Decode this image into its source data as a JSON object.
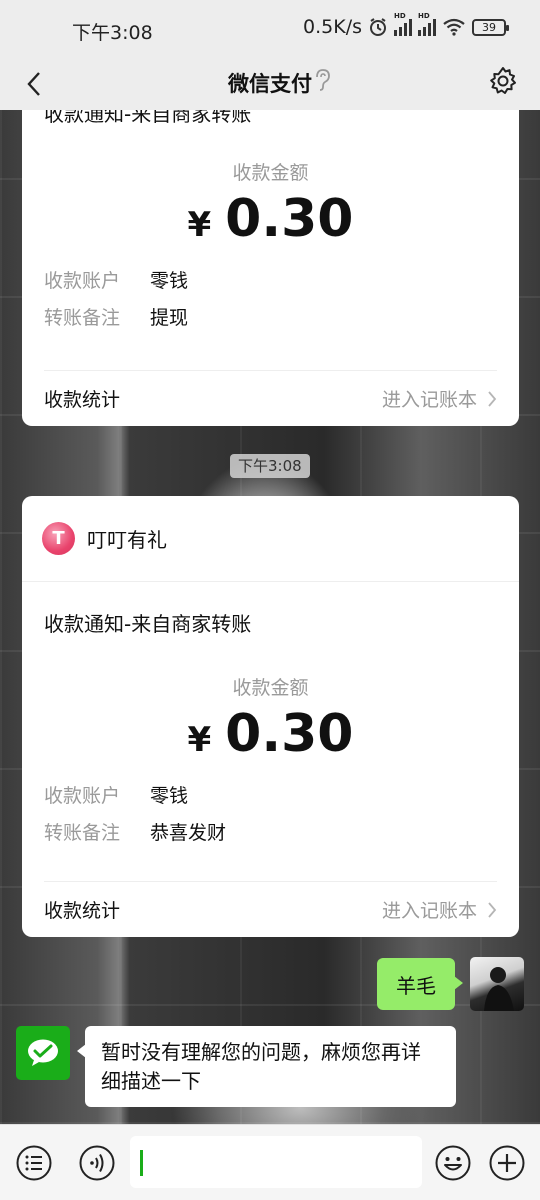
{
  "status_bar": {
    "time": "下午3:08",
    "network_speed": "0.5K/s",
    "battery": "39"
  },
  "nav": {
    "title": "微信支付"
  },
  "cards": [
    {
      "title": "收款通知-来自商家转账",
      "amount_label": "收款金额",
      "currency": "¥",
      "amount": "0.30",
      "details": [
        {
          "key": "收款账户",
          "value": "零钱"
        },
        {
          "key": "转账备注",
          "value": "提现"
        }
      ],
      "footer_left": "收款统计",
      "footer_right": "进入记账本"
    },
    {
      "brand": "叮叮有礼",
      "title": "收款通知-来自商家转账",
      "amount_label": "收款金额",
      "currency": "¥",
      "amount": "0.30",
      "details": [
        {
          "key": "收款账户",
          "value": "零钱"
        },
        {
          "key": "转账备注",
          "value": "恭喜发财"
        }
      ],
      "footer_left": "收款统计",
      "footer_right": "进入记账本"
    }
  ],
  "timestamp": "下午3:08",
  "messages": [
    {
      "from": "user",
      "text": "羊毛"
    },
    {
      "from": "bot",
      "text": "暂时没有理解您的问题，麻烦您再详细描述一下"
    }
  ],
  "colors": {
    "bubble_out": "#95ec69",
    "wechat_green": "#1aad19",
    "brand_pink": "#e9436c"
  },
  "icons": [
    "back-arrow-icon",
    "ear-icon",
    "gear-icon",
    "chevron-right-icon",
    "menu-list-icon",
    "voice-icon",
    "emoji-icon",
    "plus-icon",
    "wechat-pay-icon"
  ]
}
